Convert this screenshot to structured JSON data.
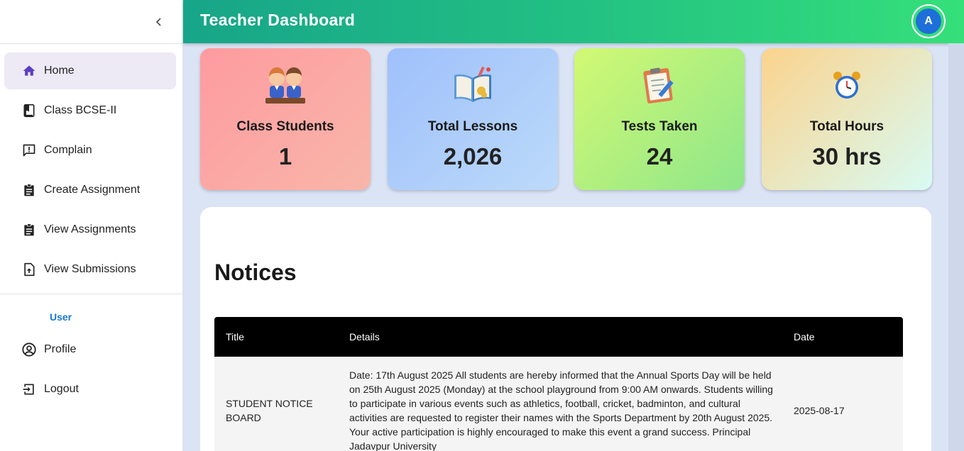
{
  "sidebar": {
    "collapse_icon": "chevron-left-icon",
    "items": [
      {
        "label": "Home",
        "icon": "home-icon",
        "active": true
      },
      {
        "label": "Class BCSE-II",
        "icon": "book-icon"
      },
      {
        "label": "Complain",
        "icon": "feedback-icon"
      },
      {
        "label": "Create Assignment",
        "icon": "assignment-icon"
      },
      {
        "label": "View Assignments",
        "icon": "assignment-icon"
      },
      {
        "label": "View Submissions",
        "icon": "upload-file-icon"
      }
    ],
    "section_label": "User",
    "user_items": [
      {
        "label": "Profile",
        "icon": "account-circle-icon"
      },
      {
        "label": "Logout",
        "icon": "logout-icon"
      }
    ]
  },
  "header": {
    "title": "Teacher Dashboard",
    "avatar_letter": "A"
  },
  "stats": [
    {
      "label": "Class Students",
      "value": "1",
      "icon": "students-emoji"
    },
    {
      "label": "Total Lessons",
      "value": "2,026",
      "icon": "book-emoji"
    },
    {
      "label": "Tests Taken",
      "value": "24",
      "icon": "clipboard-emoji"
    },
    {
      "label": "Total Hours",
      "value": "30 hrs",
      "icon": "alarm-clock-emoji"
    }
  ],
  "notices": {
    "title": "Notices",
    "columns": [
      "Title",
      "Details",
      "Date"
    ],
    "rows": [
      {
        "title": "STUDENT NOTICE BOARD",
        "details": "Date: 17th August 2025 All students are hereby informed that the Annual Sports Day will be held on 25th August 2025 (Monday) at the school playground from 9:00 AM onwards. Students willing to participate in various events such as athletics, football, cricket, badminton, and cultural activities are requested to register their names with the Sports Department by 20th August 2025. Your active participation is highly encouraged to make this event a grand success. Principal Jadavpur University",
        "date": "2025-08-17"
      }
    ]
  },
  "colors": {
    "header_start": "#17a589",
    "header_end": "#35e07a",
    "accent_purple": "#6a3fc8",
    "section_blue": "#1976d2",
    "avatar_blue": "#1e6fd9"
  }
}
